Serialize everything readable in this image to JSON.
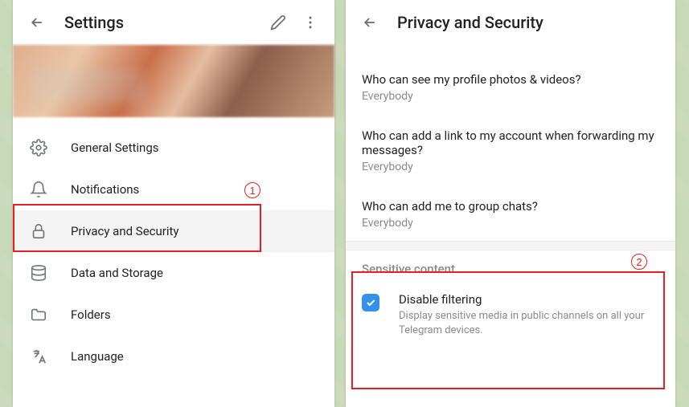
{
  "left": {
    "title": "Settings",
    "items": [
      {
        "icon": "gear-icon",
        "label": "General Settings"
      },
      {
        "icon": "bell-icon",
        "label": "Notifications"
      },
      {
        "icon": "lock-icon",
        "label": "Privacy and Security"
      },
      {
        "icon": "database-icon",
        "label": "Data and Storage"
      },
      {
        "icon": "folder-icon",
        "label": "Folders"
      },
      {
        "icon": "language-icon",
        "label": "Language"
      }
    ]
  },
  "right": {
    "title": "Privacy and Security",
    "privacy_items": [
      {
        "title": "Who can see my profile photos & videos?",
        "value": "Everybody"
      },
      {
        "title": "Who can add a link to my account when forwarding my messages?",
        "value": "Everybody"
      },
      {
        "title": "Who can add me to group chats?",
        "value": "Everybody"
      }
    ],
    "sensitive": {
      "header": "Sensitive content",
      "checkbox_checked": true,
      "filter_title": "Disable filtering",
      "filter_desc": "Display sensitive media in public channels on all your Telegram devices."
    }
  },
  "annotations": {
    "num1": "1",
    "num2": "2"
  }
}
